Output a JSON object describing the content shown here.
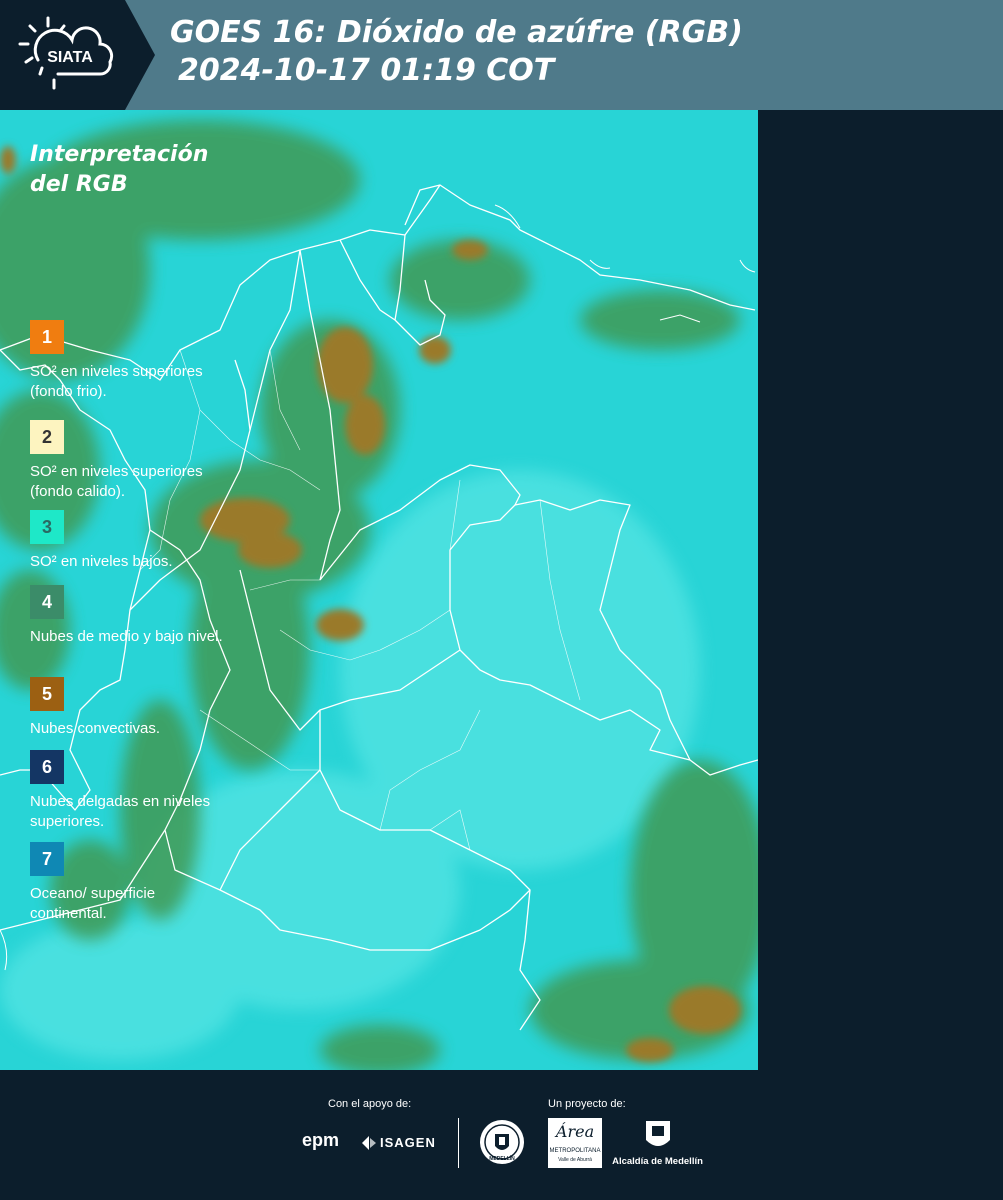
{
  "header": {
    "logo_text": "SIATA",
    "title_line1": "GOES 16: Dióxido de azúfre (RGB)",
    "title_line2": "2024-10-17 01:19 COT"
  },
  "legend": {
    "title": "Interpretación del RGB",
    "items": [
      {
        "number": "1",
        "color": "#f07d10",
        "text_color": "#ffffff",
        "label": "SO² en niveles superiores (fondo frio)."
      },
      {
        "number": "2",
        "color": "#fdf4c0",
        "text_color": "#333333",
        "label": "SO² en niveles superiores (fondo calido)."
      },
      {
        "number": "3",
        "color": "#1ee8c8",
        "text_color": "#2a6a63",
        "label": "SO² en niveles bajos."
      },
      {
        "number": "4",
        "color": "#3b8c69",
        "text_color": "#ffffff",
        "label": "Nubes de medio y bajo nivel."
      },
      {
        "number": "5",
        "color": "#9c6012",
        "text_color": "#ffffff",
        "label": "Nubes convectivas."
      },
      {
        "number": "6",
        "color": "#143664",
        "text_color": "#ffffff",
        "label": "Nubes delgadas en niveles superiores."
      },
      {
        "number": "7",
        "color": "#0f88b4",
        "text_color": "#ffffff",
        "label": "Oceano/ superficie continental."
      }
    ]
  },
  "footer": {
    "support_label": "Con el apoyo de:",
    "project_label": "Un proyecto de:",
    "logo_epm": "epm",
    "logo_isagen": "ISAGEN",
    "logo_area": "Área",
    "logo_area_sub1": "METROPOLITANA",
    "logo_area_sub2": "Valle de Aburrá",
    "logo_alcaldia": "Alcaldía de Medellín",
    "seal_text": "MEDELLÍN"
  },
  "colors": {
    "header_bg": "#4f7a8a",
    "panel_bg": "#0c1e2c",
    "map_cyan": "#28d4d6",
    "cloud_green": "#3f9a55",
    "cloud_brown": "#9a7a2a"
  }
}
